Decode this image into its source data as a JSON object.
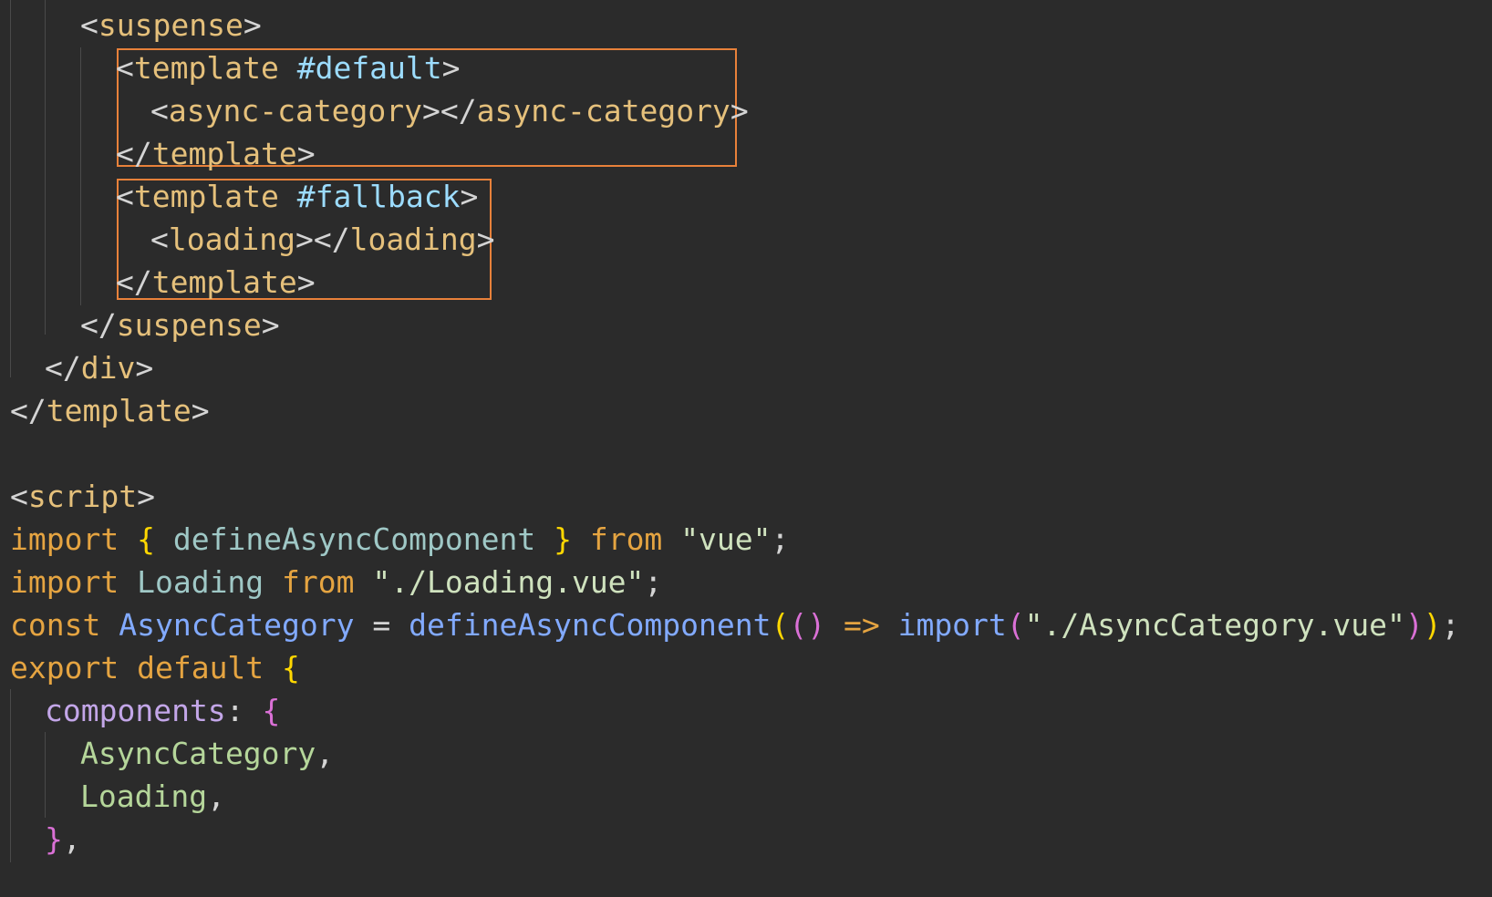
{
  "code": {
    "l1": [
      "<",
      "suspense",
      ">"
    ],
    "l2": [
      "<",
      "template",
      " ",
      "#default",
      ">"
    ],
    "l3": [
      "<",
      "async-category",
      ">",
      "</",
      "async-category",
      ">"
    ],
    "l4": [
      "</",
      "template",
      ">"
    ],
    "l5": [
      "<",
      "template",
      " ",
      "#fallback",
      ">"
    ],
    "l6": [
      "<",
      "loading",
      ">",
      "</",
      "loading",
      ">"
    ],
    "l7": [
      "</",
      "template",
      ">"
    ],
    "l8": [
      "</",
      "suspense",
      ">"
    ],
    "l9": [
      "</",
      "div",
      ">"
    ],
    "l10": [
      "</",
      "template",
      ">"
    ],
    "l12": [
      "<",
      "script",
      ">"
    ],
    "l13": [
      "import",
      " ",
      "{",
      " ",
      "defineAsyncComponent",
      " ",
      "}",
      " ",
      "from",
      " ",
      "\"vue\"",
      ";"
    ],
    "l14": [
      "import",
      " ",
      "Loading",
      " ",
      "from",
      " ",
      "\"./Loading.vue\"",
      ";"
    ],
    "l15": [
      "const",
      " ",
      "AsyncCategory",
      " = ",
      "defineAsyncComponent",
      "(",
      "()",
      " => ",
      "import",
      "(",
      "\"./AsyncCategory.vue\"",
      ")",
      ")",
      ";"
    ],
    "l16": [
      "export",
      " ",
      "default",
      " ",
      "{"
    ],
    "l17": [
      "components",
      ": ",
      "{"
    ],
    "l18": [
      "AsyncCategory",
      ","
    ],
    "l19": [
      "Loading",
      ","
    ],
    "l20": [
      "}",
      ","
    ]
  },
  "colors": {
    "background": "#2b2b2b",
    "highlight_box": "#e8813a"
  }
}
